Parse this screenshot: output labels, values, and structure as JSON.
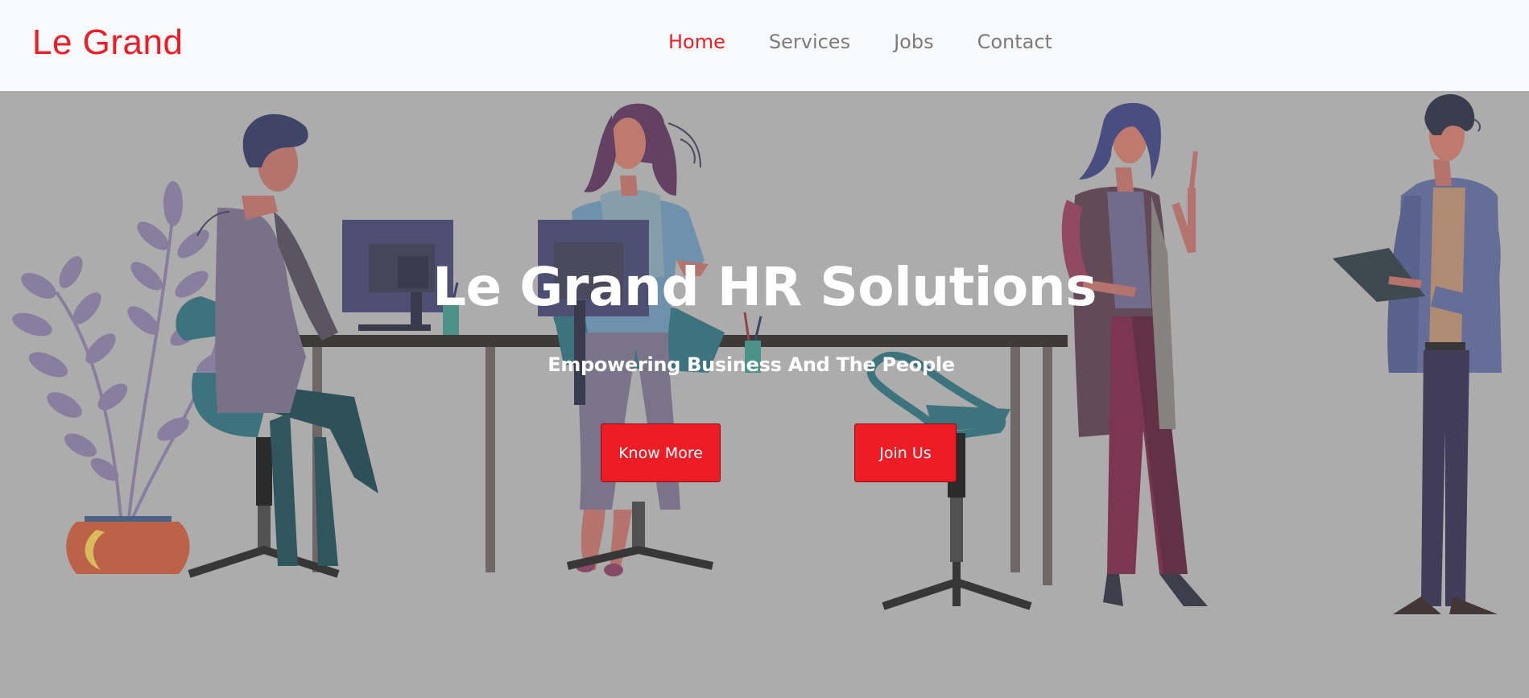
{
  "brand": {
    "name": "Le Grand"
  },
  "nav": {
    "items": [
      {
        "label": "Home",
        "active": true
      },
      {
        "label": "Services",
        "active": false
      },
      {
        "label": "Jobs",
        "active": false
      },
      {
        "label": "Contact",
        "active": false
      }
    ]
  },
  "hero": {
    "title": "Le Grand HR Solutions",
    "subtitle": "Empowering Business And The People",
    "buttons": {
      "know_more": "Know More",
      "join_us": "Join Us"
    }
  },
  "colors": {
    "accent": "#ee1c25",
    "navbar_bg": "#f8f9fa",
    "nav_text": "#7b7b7b",
    "hero_bg": "#acacac",
    "hero_text": "#ffffff"
  },
  "illustration": {
    "icons": [
      "plant-icon",
      "person-sitting-icon",
      "monitor-icon",
      "desk-icon",
      "office-chair-icon",
      "person-standing-icon",
      "clipboard-icon"
    ]
  }
}
